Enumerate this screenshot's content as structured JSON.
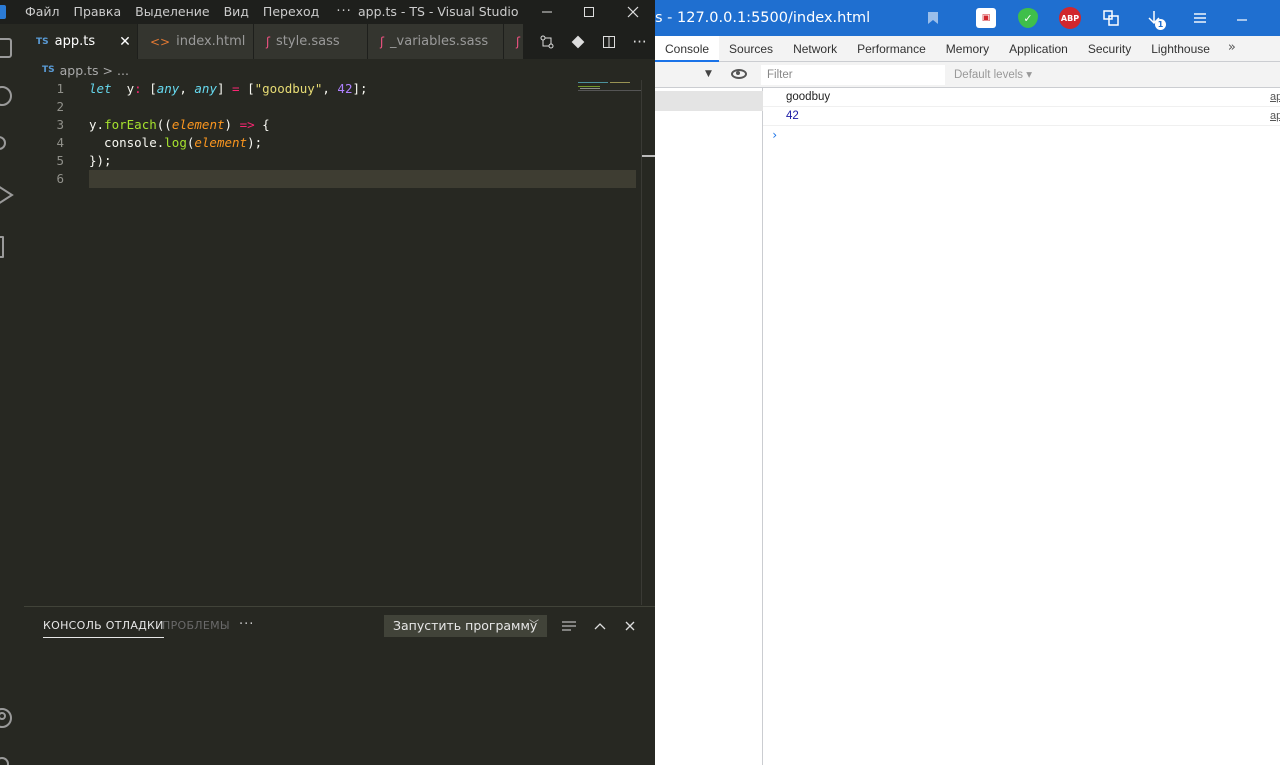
{
  "vscode": {
    "menu": [
      "Файл",
      "Правка",
      "Выделение",
      "Вид",
      "Переход"
    ],
    "menu_more": "···",
    "window_title": "app.ts - TS - Visual Studio Cod...",
    "tabs": [
      {
        "badge": "TS",
        "label": "app.ts",
        "close": "✕"
      },
      {
        "label": "index.html"
      },
      {
        "label": "style.sass"
      },
      {
        "label": "_variables.sass"
      }
    ],
    "breadcrumb": {
      "badge": "TS",
      "file": "app.ts",
      "sep": ">",
      "rest": "..."
    },
    "code_lines": [
      {
        "n": "1",
        "tokens": [
          [
            "kw",
            "let"
          ],
          [
            "",
            "  y"
          ],
          [
            "op",
            ":"
          ],
          [
            "",
            " ["
          ],
          [
            "ty",
            "any"
          ],
          [
            "",
            ", "
          ],
          [
            "ty",
            "any"
          ],
          [
            "",
            "] "
          ],
          [
            "op",
            "="
          ],
          [
            "",
            " ["
          ],
          [
            "str",
            "\"goodbuy\""
          ],
          [
            "",
            ", "
          ],
          [
            "num",
            "42"
          ],
          [
            "",
            "];"
          ]
        ]
      },
      {
        "n": "2",
        "tokens": []
      },
      {
        "n": "3",
        "tokens": [
          [
            "",
            "y."
          ],
          [
            "fn",
            "forEach"
          ],
          [
            "",
            "(("
          ],
          [
            "pm",
            "element"
          ],
          [
            "",
            ") "
          ],
          [
            "op",
            "=>"
          ],
          [
            "",
            " {"
          ]
        ]
      },
      {
        "n": "4",
        "tokens": [
          [
            "",
            "  console."
          ],
          [
            "fn",
            "log"
          ],
          [
            "",
            "("
          ],
          [
            "pm",
            "element"
          ],
          [
            "",
            "); "
          ]
        ]
      },
      {
        "n": "5",
        "tokens": [
          [
            "",
            "});"
          ]
        ]
      },
      {
        "n": "6",
        "tokens": []
      }
    ],
    "panel": {
      "active_tab": "КОНСОЛЬ ОТЛАДКИ",
      "inactive_tab": "ПРОБЛЕМЫ",
      "more": "···",
      "run_config": "Запустить программу"
    }
  },
  "browser": {
    "title": "s - 127.0.0.1:5500/index.html",
    "download_count": "1",
    "abp": "ABP",
    "devtools_tabs": [
      "Console",
      "Sources",
      "Network",
      "Performance",
      "Memory",
      "Application",
      "Security",
      "Lighthouse"
    ],
    "more_tabs": "»",
    "filter_placeholder": "Filter",
    "levels": "Default levels ▾",
    "messages": [
      {
        "text": "goodbuy",
        "src": "ap"
      },
      {
        "text": "42",
        "src": "ap"
      }
    ],
    "prompt": "›"
  }
}
